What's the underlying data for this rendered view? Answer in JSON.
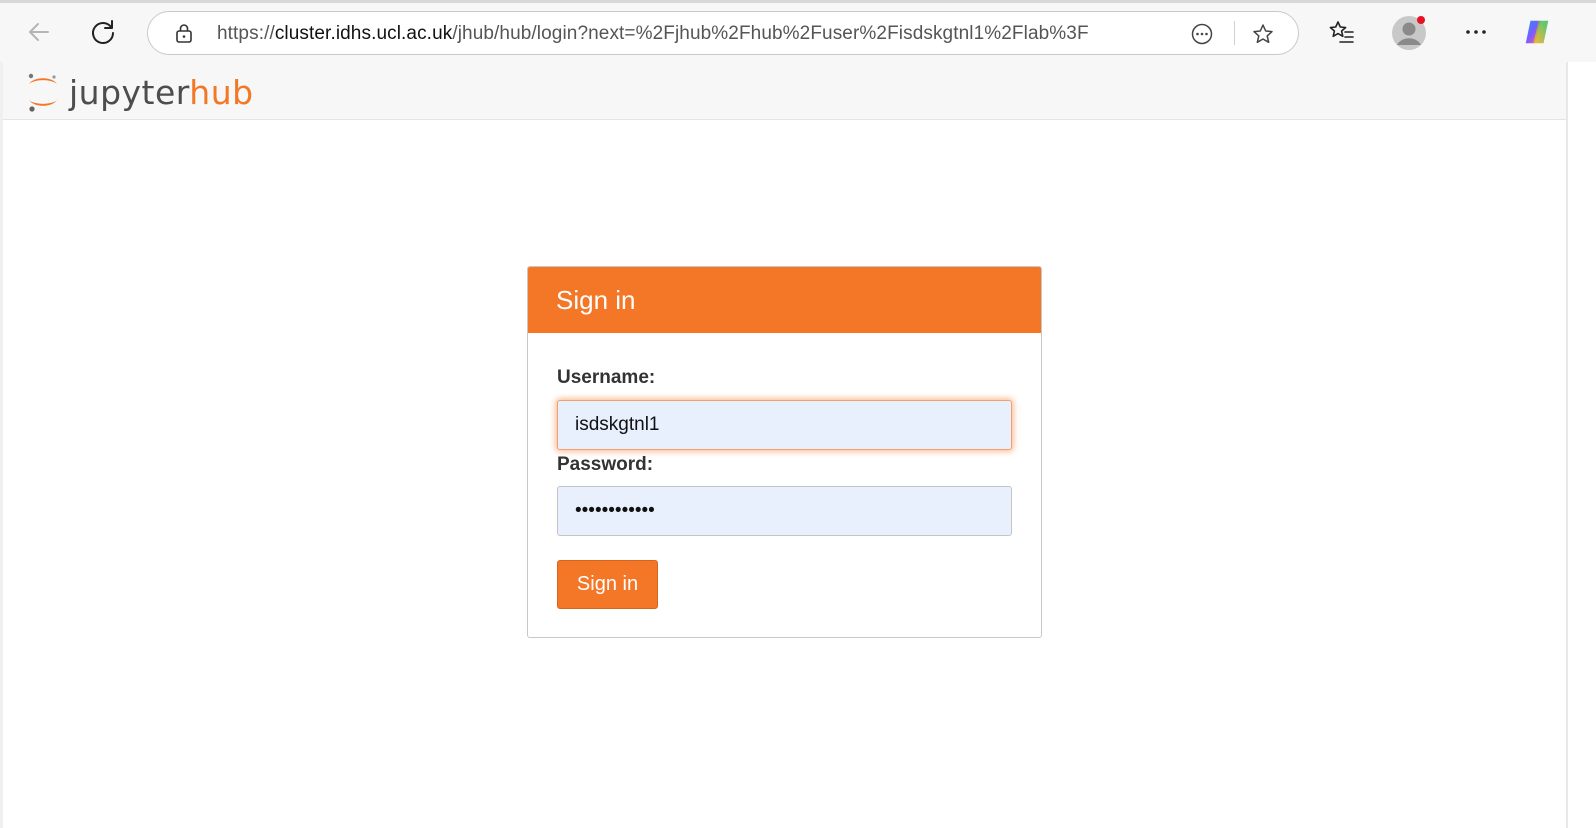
{
  "browser": {
    "url_prefix": "https://",
    "url_host": "cluster.idhs.ucl.ac.uk",
    "url_path": "/jhub/hub/login?next=%2Fjhub%2Fhub%2Fuser%2Fisdskgtnl1%2Flab%3F",
    "icons": {
      "back": "back-arrow-icon",
      "refresh": "refresh-icon",
      "lock": "lock-icon",
      "more_tools": "more-options-circle-icon",
      "favorite": "star-icon",
      "favorites_list": "favorites-icon",
      "profile": "profile-avatar-icon",
      "menu": "ellipsis-icon",
      "copilot": "copilot-icon"
    },
    "profile_badge_color": "#e81123"
  },
  "header": {
    "logo_primary": "jupyter",
    "logo_accent": "hub"
  },
  "login": {
    "title": "Sign in",
    "username_label": "Username:",
    "username_value": "isdskgtnl1",
    "password_label": "Password:",
    "password_value": "••••••••••••",
    "submit_label": "Sign in"
  },
  "colors": {
    "accent": "#f37726",
    "input_bg": "#e8f0fe"
  }
}
